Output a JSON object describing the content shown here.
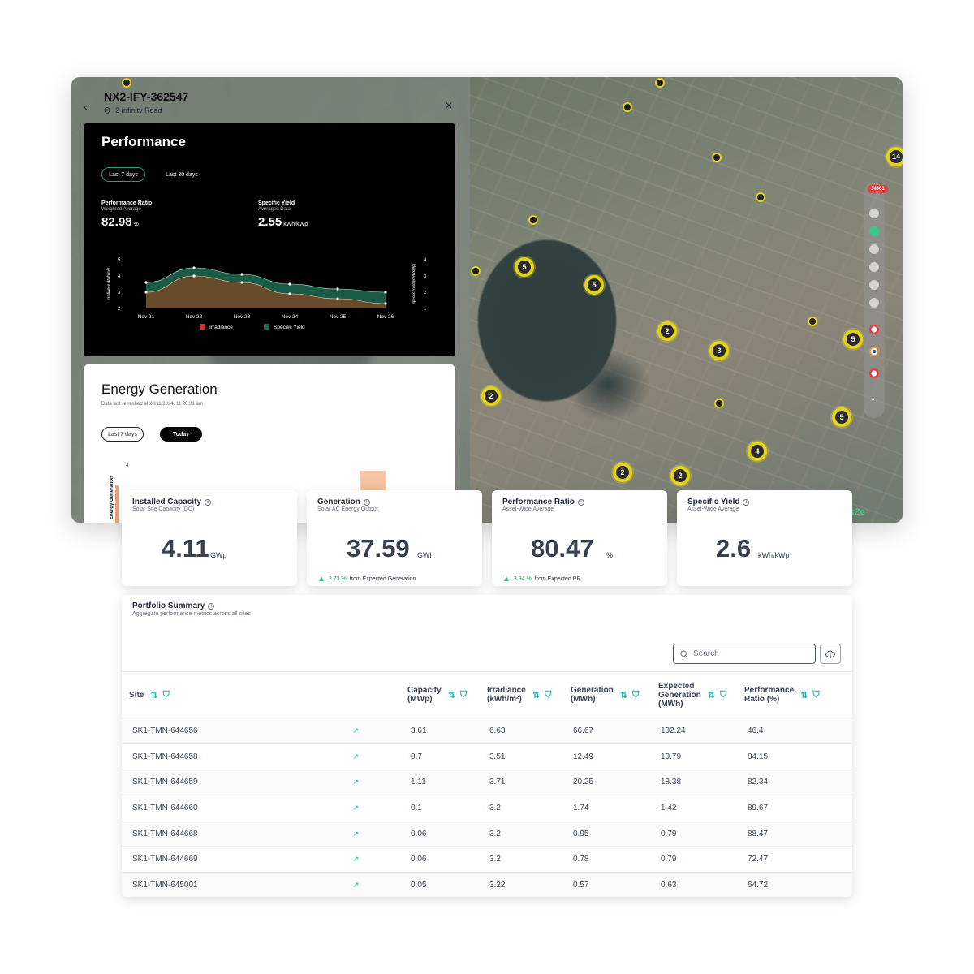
{
  "site": {
    "id": "NX2-IFY-362547",
    "address": "2 Infinity Road"
  },
  "performance": {
    "title": "Performance",
    "tabs": [
      "Last 7 days",
      "Last 30 days"
    ],
    "active_tab": "Last 7 days",
    "ratio": {
      "label": "Performance Ratio",
      "sub": "Weighted Average",
      "value": "82.98",
      "unit": "%"
    },
    "yield": {
      "label": "Specific Yield",
      "sub": "Averaged Data",
      "value": "2.55",
      "unit": "kWh/kWp"
    },
    "chart": {
      "categories": [
        "Nov 21",
        "Nov 22",
        "Nov 23",
        "Nov 24",
        "Nov 25",
        "Nov 26"
      ],
      "left_ticks": [
        "5",
        "4",
        "3",
        "2"
      ],
      "right_ticks": [
        "4",
        "3",
        "2",
        "1"
      ],
      "left_axis_label": "Irradiance (kWh/m²)",
      "right_axis_label": "Specific Yield (kWh/kWp)",
      "legend": [
        "Irradiance",
        "Specific Yield"
      ],
      "colors": {
        "irradiance": "#6b4b2a",
        "yield": "#1f6b52"
      },
      "series": [
        {
          "name": "Irradiance",
          "values": [
            3.6,
            4.5,
            4.1,
            3.5,
            3.2,
            3.0
          ]
        },
        {
          "name": "Specific Yield",
          "values": [
            3.0,
            4.0,
            3.6,
            2.9,
            2.6,
            2.3
          ]
        }
      ]
    }
  },
  "energy": {
    "title": "Energy Generation",
    "refreshed": "Data last refreshed at 28/11/2024, 11:20:31 am",
    "tabs": [
      "Last 7 days",
      "Today"
    ],
    "active_tab": "Today",
    "y_label": "Energy Generation",
    "y_tick": "4"
  },
  "map": {
    "alert_count": "34363",
    "brand": "etZe",
    "clusters": [
      "14",
      "5",
      "5",
      "2",
      "3",
      "5",
      "2",
      "5",
      "4",
      "2",
      "2"
    ]
  },
  "kpis": [
    {
      "title": "Installed Capacity",
      "sub": "Solar Site Capacity (DC)",
      "value": "4.11",
      "unit": "GWp",
      "delta": "",
      "delta_text": ""
    },
    {
      "title": "Generation",
      "sub": "Solar AC Energy Output",
      "value": "37.59",
      "unit": "GWh",
      "delta": "3.73 %",
      "delta_text": "from Expected Generation"
    },
    {
      "title": "Performance Ratio",
      "sub": "Asset-Wide Average",
      "value": "80.47",
      "unit": "%",
      "delta": "3.94 %",
      "delta_text": "from Expected PR"
    },
    {
      "title": "Specific Yield",
      "sub": "Asset-Wide Average",
      "value": "2.6",
      "unit": "kWh/kWp",
      "delta": "",
      "delta_text": ""
    }
  ],
  "portfolio": {
    "title": "Portfolio Summary",
    "sub": "Aggregate performance metrics across all sites",
    "search_placeholder": "Search",
    "columns": {
      "site": "Site",
      "capacity": [
        "Capacity",
        "(MWp)"
      ],
      "irradiance": [
        "Irradiance",
        "(kWh/m²)"
      ],
      "generation": [
        "Generation",
        "(MWh)"
      ],
      "expected": [
        "Expected",
        "Generation",
        "(MWh)"
      ],
      "pr": [
        "Performance",
        "Ratio (%)"
      ]
    },
    "rows": [
      {
        "site": "SK1-TMN-644656",
        "capacity": "3.61",
        "irradiance": "6.63",
        "generation": "66.67",
        "expected": "102.24",
        "pr": "46.4"
      },
      {
        "site": "SK1-TMN-644658",
        "capacity": "0.7",
        "irradiance": "3.51",
        "generation": "12.49",
        "expected": "10.79",
        "pr": "84.15"
      },
      {
        "site": "SK1-TMN-644659",
        "capacity": "1.11",
        "irradiance": "3.71",
        "generation": "20.25",
        "expected": "18.38",
        "pr": "82.34"
      },
      {
        "site": "SK1-TMN-644660",
        "capacity": "0.1",
        "irradiance": "3.2",
        "generation": "1.74",
        "expected": "1.42",
        "pr": "89.67"
      },
      {
        "site": "SK1-TMN-644668",
        "capacity": "0.06",
        "irradiance": "3.2",
        "generation": "0.95",
        "expected": "0.79",
        "pr": "88.47"
      },
      {
        "site": "SK1-TMN-644669",
        "capacity": "0.06",
        "irradiance": "3.2",
        "generation": "0.78",
        "expected": "0.79",
        "pr": "72.47"
      },
      {
        "site": "SK1-TMN-645001",
        "capacity": "0.05",
        "irradiance": "3.22",
        "generation": "0.57",
        "expected": "0.63",
        "pr": "64.72"
      }
    ]
  }
}
